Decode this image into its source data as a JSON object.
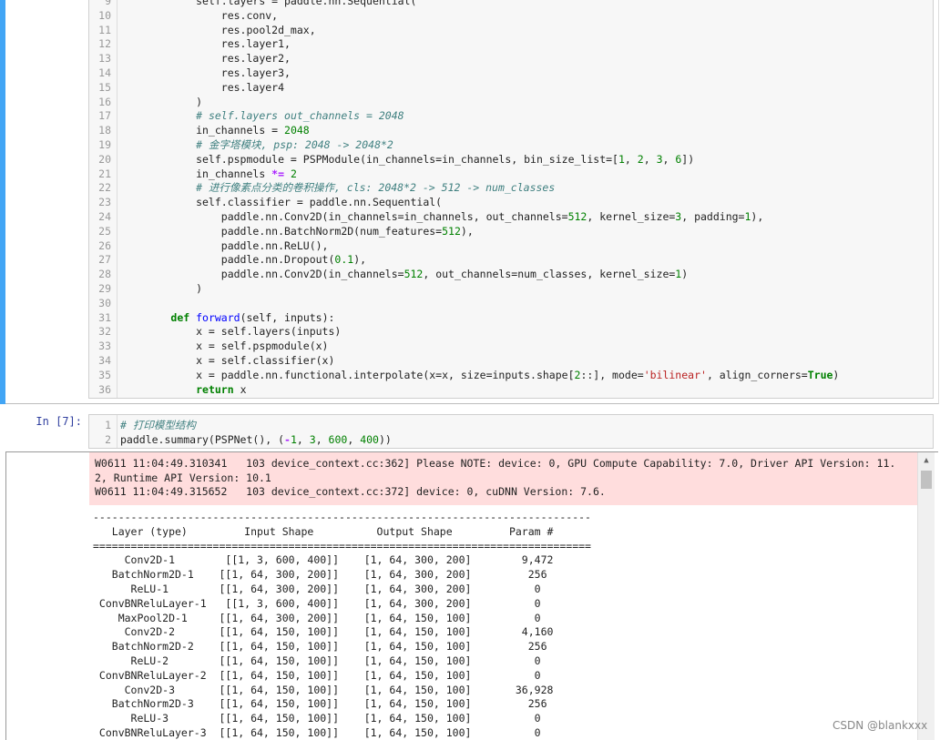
{
  "cell1": {
    "lines": [
      {
        "n": "9",
        "html": "            self.layers = paddle.nn.Sequential("
      },
      {
        "n": "10",
        "html": "                res.conv,"
      },
      {
        "n": "11",
        "html": "                res.pool2d_max,"
      },
      {
        "n": "12",
        "html": "                res.layer1,"
      },
      {
        "n": "13",
        "html": "                res.layer2,"
      },
      {
        "n": "14",
        "html": "                res.layer3,"
      },
      {
        "n": "15",
        "html": "                res.layer4"
      },
      {
        "n": "16",
        "html": "            )"
      },
      {
        "n": "17",
        "html": "            <span class=\"cm\"># self.layers out_channels = 2048</span>"
      },
      {
        "n": "18",
        "html": "            in_channels = <span class=\"num\">2048</span>"
      },
      {
        "n": "19",
        "html": "            <span class=\"cm\"># 金字塔模块, psp: 2048 -&gt; 2048*2</span>"
      },
      {
        "n": "20",
        "html": "            self.pspmodule = PSPModule(in_channels=in_channels, bin_size_list=[<span class=\"num\">1</span>, <span class=\"num\">2</span>, <span class=\"num\">3</span>, <span class=\"num\">6</span>])"
      },
      {
        "n": "21",
        "html": "            in_channels <span class=\"op\">*=</span> <span class=\"num\">2</span>"
      },
      {
        "n": "22",
        "html": "            <span class=\"cm\"># 进行像素点分类的卷积操作, cls: 2048*2 -&gt; 512 -&gt; num_classes</span>"
      },
      {
        "n": "23",
        "html": "            self.classifier = paddle.nn.Sequential("
      },
      {
        "n": "24",
        "html": "                paddle.nn.Conv2D(in_channels=in_channels, out_channels=<span class=\"num\">512</span>, kernel_size=<span class=\"num\">3</span>, padding=<span class=\"num\">1</span>),"
      },
      {
        "n": "25",
        "html": "                paddle.nn.BatchNorm2D(num_features=<span class=\"num\">512</span>),"
      },
      {
        "n": "26",
        "html": "                paddle.nn.ReLU(),"
      },
      {
        "n": "27",
        "html": "                paddle.nn.Dropout(<span class=\"num\">0.1</span>),"
      },
      {
        "n": "28",
        "html": "                paddle.nn.Conv2D(in_channels=<span class=\"num\">512</span>, out_channels=num_classes, kernel_size=<span class=\"num\">1</span>)"
      },
      {
        "n": "29",
        "html": "            )"
      },
      {
        "n": "30",
        "html": ""
      },
      {
        "n": "31",
        "html": "        <span class=\"kw\">def</span> <span class=\"fn\">forward</span>(self, inputs):"
      },
      {
        "n": "32",
        "html": "            x = self.layers(inputs)"
      },
      {
        "n": "33",
        "html": "            x = self.pspmodule(x)"
      },
      {
        "n": "34",
        "html": "            x = self.classifier(x)"
      },
      {
        "n": "35",
        "html": "            x = paddle.nn.functional.interpolate(x=x, size=inputs.shape[<span class=\"num\">2</span>::], mode=<span class=\"str\">'bilinear'</span>, align_corners=<span class=\"kw\">True</span>)"
      },
      {
        "n": "36",
        "html": "            <span class=\"kw\">return</span> x"
      }
    ]
  },
  "cell2": {
    "prompt": "In  [7]:",
    "lines": [
      {
        "n": "1",
        "html": "<span class=\"cm\"># 打印模型结构</span>"
      },
      {
        "n": "2",
        "html": "paddle.summary(PSPNet(), (<span class=\"op\">-</span><span class=\"num\">1</span>, <span class=\"num\">3</span>, <span class=\"num\">600</span>, <span class=\"num\">400</span>))"
      }
    ]
  },
  "output": {
    "stderr": "W0611 11:04:49.310341   103 device_context.cc:362] Please NOTE: device: 0, GPU Compute Capability: 7.0, Driver API Version: 11.\n2, Runtime API Version: 10.1\nW0611 11:04:49.315652   103 device_context.cc:372] device: 0, cuDNN Version: 7.6.",
    "stdout": "-------------------------------------------------------------------------------\n   Layer (type)         Input Shape          Output Shape         Param #    \n===============================================================================\n     Conv2D-1        [[1, 3, 600, 400]]    [1, 64, 300, 200]        9,472     \n   BatchNorm2D-1    [[1, 64, 300, 200]]    [1, 64, 300, 200]         256      \n      ReLU-1        [[1, 64, 300, 200]]    [1, 64, 300, 200]          0       \n ConvBNReluLayer-1   [[1, 3, 600, 400]]    [1, 64, 300, 200]          0       \n    MaxPool2D-1     [[1, 64, 300, 200]]    [1, 64, 150, 100]          0       \n     Conv2D-2       [[1, 64, 150, 100]]    [1, 64, 150, 100]        4,160     \n   BatchNorm2D-2    [[1, 64, 150, 100]]    [1, 64, 150, 100]         256      \n      ReLU-2        [[1, 64, 150, 100]]    [1, 64, 150, 100]          0       \n ConvBNReluLayer-2  [[1, 64, 150, 100]]    [1, 64, 150, 100]          0       \n     Conv2D-3       [[1, 64, 150, 100]]    [1, 64, 150, 100]       36,928     \n   BatchNorm2D-3    [[1, 64, 150, 100]]    [1, 64, 150, 100]         256      \n      ReLU-3        [[1, 64, 150, 100]]    [1, 64, 150, 100]          0       \n ConvBNReluLayer-3  [[1, 64, 150, 100]]    [1, 64, 150, 100]          0       "
  },
  "watermark": "CSDN @blankxxx"
}
